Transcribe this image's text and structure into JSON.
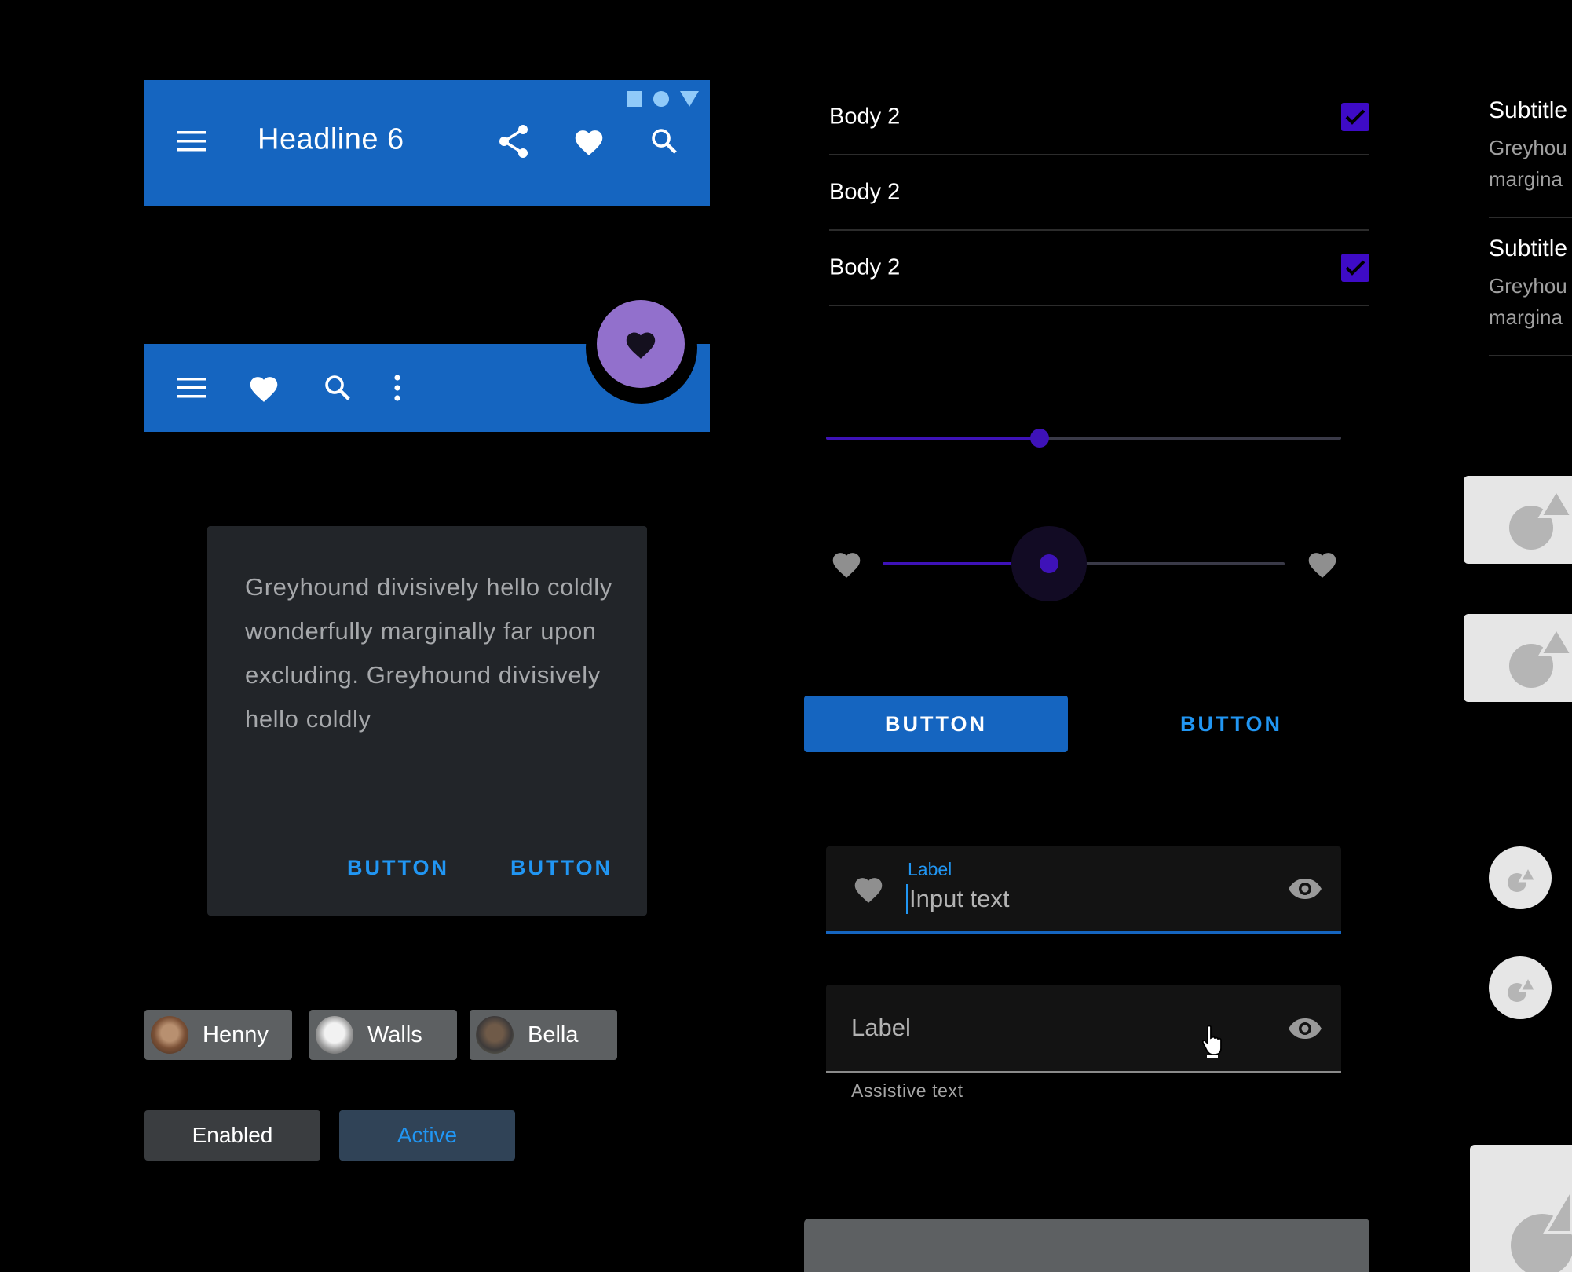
{
  "top_app_bar": {
    "title": "Headline 6",
    "status_icons": [
      "square-icon",
      "circle-icon",
      "triangle-icon"
    ],
    "actions": [
      "share-icon",
      "heart-icon",
      "search-icon"
    ],
    "background": "#1565c0"
  },
  "bottom_app_bar": {
    "actions": [
      "menu-icon",
      "heart-icon",
      "search-icon",
      "more-vert-icon"
    ],
    "fab_icon": "heart-icon",
    "fab_color": "#9270cc"
  },
  "dialog": {
    "body": "Greyhound divisively hello coldly wonderfully marginally far upon excluding. Greyhound divisively hello coldly",
    "buttons": [
      "BUTTON",
      "BUTTON"
    ]
  },
  "chips": [
    {
      "label": "Henny"
    },
    {
      "label": "Walls"
    },
    {
      "label": "Bella"
    }
  ],
  "filter_chips": {
    "enabled": "Enabled",
    "active": "Active"
  },
  "list": [
    {
      "label": "Body 2",
      "checked": true
    },
    {
      "label": "Body 2",
      "checked": false
    },
    {
      "label": "Body 2",
      "checked": true
    }
  ],
  "sliders": {
    "continuous_value": 0.415,
    "discrete_value": 0.415,
    "start_icon": "heart-icon",
    "end_icon": "heart-icon",
    "accent": "#3e12b8"
  },
  "buttons": {
    "contained": "BUTTON",
    "text": "BUTTON"
  },
  "text_field_focused": {
    "label": "Label",
    "value": "Input text",
    "leading_icon": "heart-icon",
    "trailing_icon": "eye-icon"
  },
  "text_field_idle": {
    "label": "Label",
    "assistive": "Assistive text",
    "trailing_icon": "eye-icon"
  },
  "right_list": [
    {
      "title": "Subtitle",
      "lines": [
        "Greyhou",
        "margina"
      ]
    },
    {
      "title": "Subtitle",
      "lines": [
        "Greyhou",
        "margina"
      ]
    }
  ]
}
